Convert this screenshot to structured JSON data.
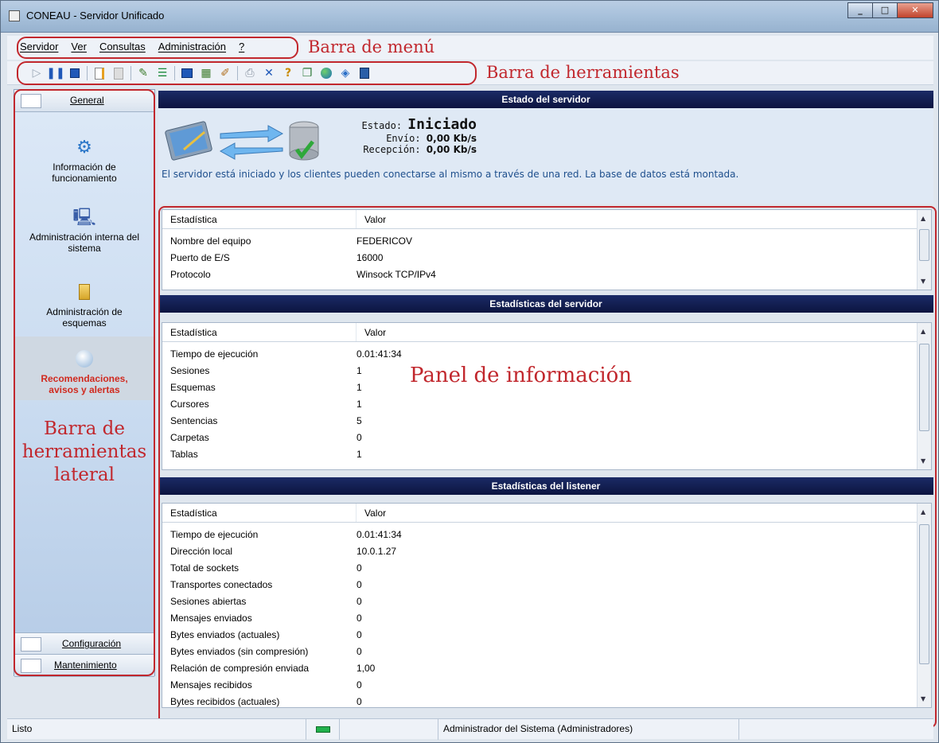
{
  "window": {
    "title": "CONEAU - Servidor Unificado",
    "controls": [
      "minimize",
      "maximize",
      "close"
    ]
  },
  "menu": {
    "items": [
      "Servidor",
      "Ver",
      "Consultas",
      "Administración",
      "?"
    ],
    "annotation": "Barra de menú"
  },
  "toolbar": {
    "icons": [
      "play-icon",
      "pause-icon",
      "stop-icon",
      "document-icon",
      "document-disabled-icon",
      "edit-icon",
      "tree-icon",
      "console-icon",
      "table-icon",
      "wand-icon",
      "print-icon",
      "delete-icon",
      "help-icon",
      "copy-icon",
      "globe-icon",
      "diamond-icon",
      "exit-icon"
    ],
    "annotation": "Barra de herramientas"
  },
  "sidebar": {
    "top_tab": "General",
    "items": [
      {
        "label": "Información de funcionamiento",
        "icon": "gears-icon"
      },
      {
        "label": "Administración interna del sistema",
        "icon": "computer-icon"
      },
      {
        "label": "Administración de esquemas",
        "icon": "folder-icon"
      },
      {
        "label": "Recomendaciones, avisos y alertas",
        "icon": "info-icon",
        "active": true
      }
    ],
    "bottom_tabs": [
      "Configuración",
      "Mantenimiento"
    ],
    "annotation": [
      "Barra de",
      "herramientas",
      "lateral"
    ]
  },
  "server_state": {
    "header": "Estado del servidor",
    "estado_label": "Estado:",
    "estado_value": "Iniciado",
    "envio_label": "Envío:",
    "envio_value": "0,00 Kb/s",
    "recepcion_label": "Recepción:",
    "recepcion_value": "0,00 Kb/s",
    "message": "El servidor está iniciado y los clientes pueden conectarse al mismo a través de una red. La base de datos está montada."
  },
  "grid_columns": {
    "stat": "Estadística",
    "value": "Valor"
  },
  "general_grid": {
    "rows": [
      [
        "Nombre del equipo",
        "FEDERICOV"
      ],
      [
        "Puerto de E/S",
        "16000"
      ],
      [
        "Protocolo",
        "Winsock TCP/IPv4"
      ]
    ]
  },
  "server_stats": {
    "header": "Estadísticas del servidor",
    "rows": [
      [
        "Tiempo de ejecución",
        "0.01:41:34"
      ],
      [
        "Sesiones",
        "1"
      ],
      [
        "Esquemas",
        "1"
      ],
      [
        "Cursores",
        "1"
      ],
      [
        "Sentencias",
        "5"
      ],
      [
        "Carpetas",
        "0"
      ],
      [
        "Tablas",
        "1"
      ]
    ]
  },
  "listener_stats": {
    "header": "Estadísticas del listener",
    "rows": [
      [
        "Tiempo de ejecución",
        "0.01:41:34"
      ],
      [
        "Dirección local",
        "10.0.1.27"
      ],
      [
        "Total de sockets",
        "0"
      ],
      [
        "Transportes conectados",
        "0"
      ],
      [
        "Sesiones abiertas",
        "0"
      ],
      [
        "Mensajes enviados",
        "0"
      ],
      [
        "Bytes enviados (actuales)",
        "0"
      ],
      [
        "Bytes enviados (sin compresión)",
        "0"
      ],
      [
        "Relación de compresión enviada",
        "1,00"
      ],
      [
        "Mensajes recibidos",
        "0"
      ],
      [
        "Bytes recibidos (actuales)",
        "0"
      ]
    ]
  },
  "panel_annotation": "Panel de información",
  "status_bar": {
    "status": "Listo",
    "user": "Administrador del Sistema (Administradores)"
  },
  "colors": {
    "annotation": "#c1272d",
    "header_bg": "#0c1440",
    "active_item": "#d02a1f",
    "message": "#1e4f8d"
  }
}
